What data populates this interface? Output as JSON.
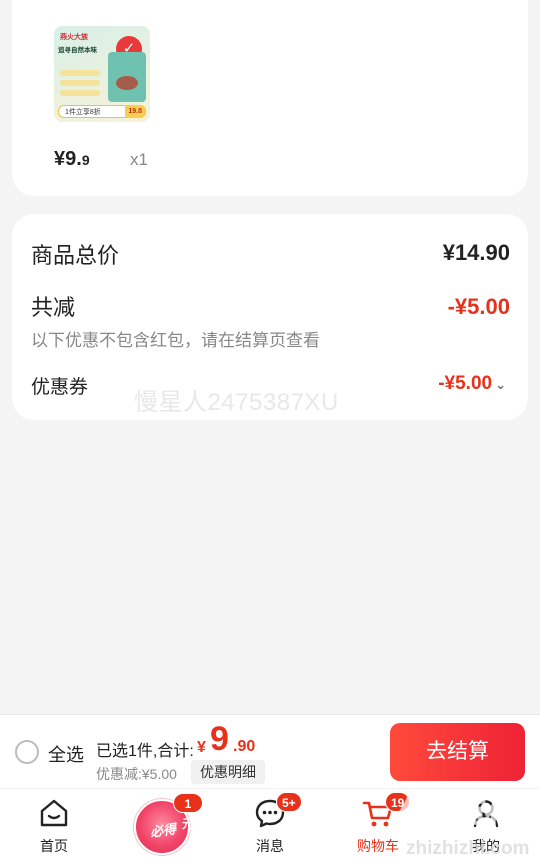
{
  "product": {
    "thumb": {
      "brand": "燕火大族",
      "slogan": "追寻自然本味",
      "promo": "1件立享8折",
      "promo_price": "19.8"
    },
    "price_symbol": "¥",
    "price_int": "9.",
    "price_dec": "9",
    "qty": "x1"
  },
  "summary": {
    "total_label": "商品总价",
    "total_value": "¥14.90",
    "reduce_label": "共减",
    "reduce_value": "-¥5.00",
    "reduce_note": "以下优惠不包含红包，请在结算页查看",
    "coupon_label": "优惠券",
    "coupon_value": "-¥5.00",
    "watermark": "慢星人2475387XU"
  },
  "checkout": {
    "select_all": "全选",
    "selected_text": "已选1件,合计:",
    "sum_symbol": "¥",
    "sum_int": "9",
    "sum_dec": ".90",
    "discount": "优惠减:¥5.00",
    "detail_button": "优惠明细",
    "checkout_button": "去结算"
  },
  "tabbar": {
    "home": "首页",
    "special_text": "必得",
    "special_badge": "1元",
    "messages": "消息",
    "messages_badge": "5+",
    "cart": "购物车",
    "cart_badge": "19",
    "mine": "我的"
  },
  "overlay": {
    "site_mark": "值值值",
    "site_url": "zhizhizhi.com"
  },
  "colors": {
    "accent": "#e8311a",
    "checkout_gradient_start": "#ff4a3a",
    "checkout_gradient_end": "#ee2236"
  }
}
